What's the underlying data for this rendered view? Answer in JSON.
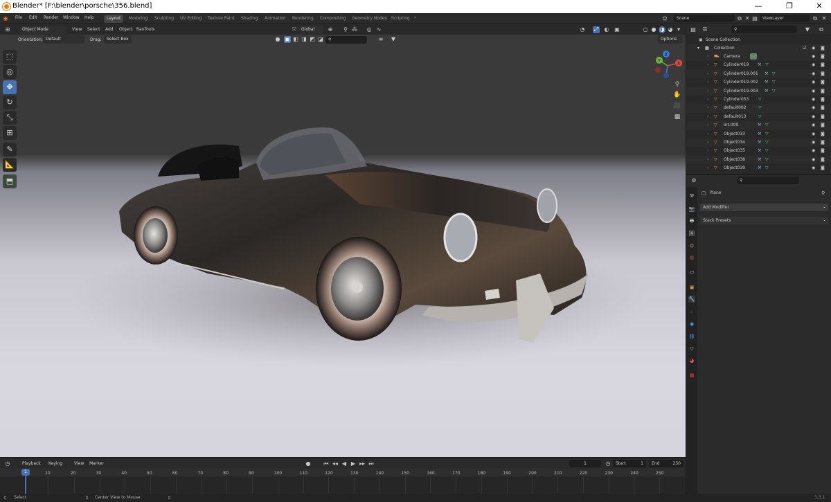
{
  "window": {
    "title": "Blender* [F:\\blender\\porsche\\356.blend]",
    "min": "—",
    "restore": "❐",
    "close": "✕"
  },
  "menu": [
    "File",
    "Edit",
    "Render",
    "Window",
    "Help"
  ],
  "workspaces": [
    "Layout",
    "Modeling",
    "Sculpting",
    "UV Editing",
    "Texture Paint",
    "Shading",
    "Animation",
    "Rendering",
    "Compositing",
    "Geometry Nodes",
    "Scripting"
  ],
  "scene": {
    "scene_name": "Scene",
    "view_layer": "ViewLayer"
  },
  "viewport": {
    "mode": "Object Mode",
    "menus": [
      "View",
      "Select",
      "Add",
      "Object",
      "RanTools"
    ],
    "transform": "Global",
    "orientation_label": "Orientation:",
    "orientation_value": "Default",
    "drag_label": "Drag:",
    "drag_value": "Select Box",
    "options": "Options",
    "gizmo": {
      "x": "X",
      "y": "Y",
      "z": "Z"
    }
  },
  "tools": [
    "select-box",
    "cursor",
    "move",
    "rotate",
    "scale",
    "transform",
    "annotate",
    "measure",
    "add-cube"
  ],
  "outliner": {
    "scene_collection": "Scene Collection",
    "collection": "Collection",
    "items": [
      "Camera",
      "Cylinder019",
      "Cylinder019.001",
      "Cylinder019.002",
      "Cylinder019.003",
      "Cylinder053",
      "default002",
      "default013",
      "int.009",
      "Object033",
      "Object034",
      "Object035",
      "Object038",
      "Object039"
    ]
  },
  "properties": {
    "object_name": "Plane",
    "add_modifier": "Add Modifier",
    "stack_presets": "Stack Presets"
  },
  "timeline": {
    "menus": [
      "Playback",
      "Keying",
      "View",
      "Marker"
    ],
    "current_frame": "1",
    "start_label": "Start",
    "start": "1",
    "end_label": "End",
    "end": "250",
    "ticks": [
      "1",
      "10",
      "20",
      "30",
      "40",
      "50",
      "60",
      "70",
      "80",
      "90",
      "100",
      "110",
      "120",
      "130",
      "140",
      "150",
      "160",
      "170",
      "180",
      "190",
      "200",
      "210",
      "220",
      "230",
      "240",
      "250"
    ]
  },
  "status": {
    "select": "Select",
    "center": "Center View to Mouse",
    "version": "3.3.1"
  },
  "colors": {
    "accent": "#4772b3",
    "car": "#2e2a28",
    "ground": "#d6d4dc"
  }
}
